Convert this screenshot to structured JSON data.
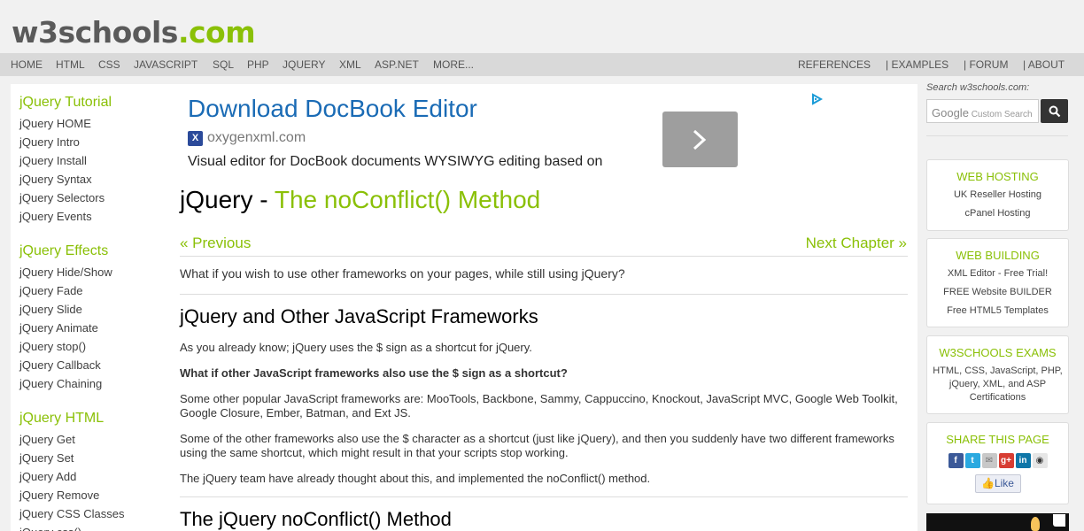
{
  "logo": {
    "name": "w3schools",
    "tld": ".com"
  },
  "topnav": {
    "left": [
      "HOME",
      "HTML",
      "CSS",
      "JAVASCRIPT",
      "SQL",
      "PHP",
      "JQUERY",
      "XML",
      "ASP.NET",
      "MORE..."
    ],
    "right": [
      "REFERENCES",
      "| EXAMPLES",
      "| FORUM",
      "| ABOUT"
    ]
  },
  "sidebar": {
    "groups": [
      {
        "title": "jQuery Tutorial",
        "items": [
          "jQuery HOME",
          "jQuery Intro",
          "jQuery Install",
          "jQuery Syntax",
          "jQuery Selectors",
          "jQuery Events"
        ]
      },
      {
        "title": "jQuery Effects",
        "items": [
          "jQuery Hide/Show",
          "jQuery Fade",
          "jQuery Slide",
          "jQuery Animate",
          "jQuery stop()",
          "jQuery Callback",
          "jQuery Chaining"
        ]
      },
      {
        "title": "jQuery HTML",
        "items": [
          "jQuery Get",
          "jQuery Set",
          "jQuery Add",
          "jQuery Remove",
          "jQuery CSS Classes",
          "jQuery css()"
        ]
      }
    ]
  },
  "ad": {
    "title": "Download DocBook Editor",
    "domain": "oxygenxml.com",
    "description": "Visual editor for DocBook documents WYSIWYG editing based on"
  },
  "page": {
    "title_prefix": "jQuery - ",
    "title_accent": "The noConflict() Method",
    "prev": "« Previous",
    "next": "Next Chapter »",
    "intro": "What if you wish to use other frameworks on your pages, while still using jQuery?",
    "section1_heading": "jQuery and Other JavaScript Frameworks",
    "p1": "As you already know; jQuery uses the $ sign as a shortcut for jQuery.",
    "p2": "What if other JavaScript frameworks also use the $ sign as a shortcut?",
    "p3": "Some other popular JavaScript frameworks are: MooTools, Backbone, Sammy, Cappuccino, Knockout, JavaScript MVC, Google Web Toolkit, Google Closure, Ember, Batman, and Ext JS.",
    "p4": "Some of the other frameworks also use the $ character as a shortcut (just like jQuery), and then you suddenly have two different frameworks using the same shortcut, which might result in that your scripts stop working.",
    "p5": "The jQuery team have already thought about this, and implemented the noConflict() method.",
    "section2_heading": "The jQuery noConflict() Method"
  },
  "search": {
    "label": "Search w3schools.com:",
    "google": "Google",
    "placeholder": "Custom Search"
  },
  "right": {
    "hosting": {
      "title": "WEB HOSTING",
      "links": [
        "UK Reseller Hosting",
        "cPanel Hosting"
      ]
    },
    "building": {
      "title": "WEB BUILDING",
      "links": [
        "XML Editor - Free Trial!",
        "FREE Website BUILDER",
        "Free HTML5 Templates"
      ]
    },
    "exams": {
      "title": "W3SCHOOLS EXAMS",
      "text": "HTML, CSS, JavaScript, PHP, jQuery, XML, and ASP Certifications"
    },
    "share": {
      "title": "SHARE THIS PAGE",
      "like": "Like"
    }
  },
  "colors": {
    "accent": "#8ac007",
    "ad_title": "#1a6bb5",
    "nav_bg": "#d9d9d9"
  },
  "icons": [
    "ad-next-arrow-icon",
    "adchoices-icon",
    "search-icon",
    "facebook-icon",
    "twitter-icon",
    "email-icon",
    "google-plus-icon",
    "linkedin-icon",
    "delicious-icon",
    "thumbs-up-icon"
  ]
}
